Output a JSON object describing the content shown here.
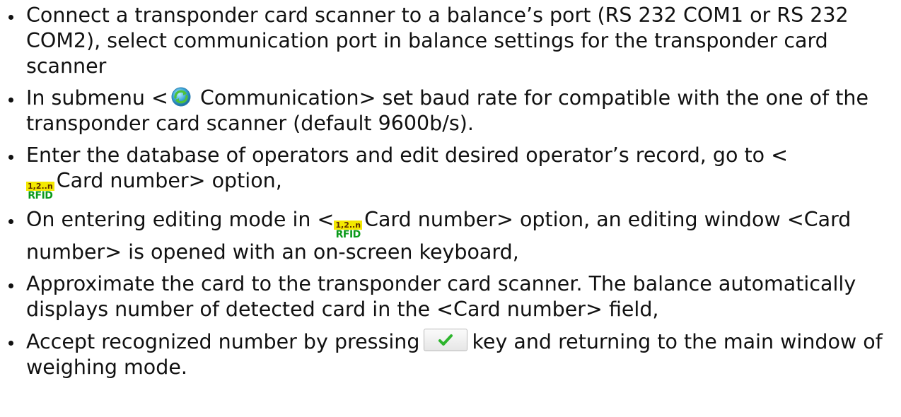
{
  "steps": [
    {
      "text": "Connect a transponder card scanner to a balance’s port (RS 232 COM1 or RS 232 COM2), select communication port in balance settings for the transponder card scanner"
    },
    {
      "before": "In submenu <",
      "icon": "communication-icon",
      "after": " Communication> set baud rate for compatible with the one of the transponder card scanner (default 9600b/s)."
    },
    {
      "before": "Enter the database of operators and edit desired operator’s record, go to <",
      "icon": "rfid-card-number-icon",
      "after": "Card number> option,"
    },
    {
      "before": "On entering editing mode in <",
      "icon": "rfid-card-number-icon",
      "after": "Card number> option, an editing window <Card number> is opened with an on-screen keyboard,"
    },
    {
      "text": "Approximate the card to the transponder card scanner. The balance automatically displays number of detected card in the <Card number> field,"
    },
    {
      "before": "Accept recognized number by pressing",
      "icon": "confirm-checkmark-key-icon",
      "after": "key and returning to the main window of weighing mode."
    }
  ],
  "rfid_icon": {
    "top_label": "1,2..n",
    "bottom_label": "RFID"
  },
  "colors": {
    "text": "#111111",
    "rfid_yellow": "#f4e800",
    "rfid_green": "#0a9a1a",
    "check_green": "#2db52d"
  }
}
